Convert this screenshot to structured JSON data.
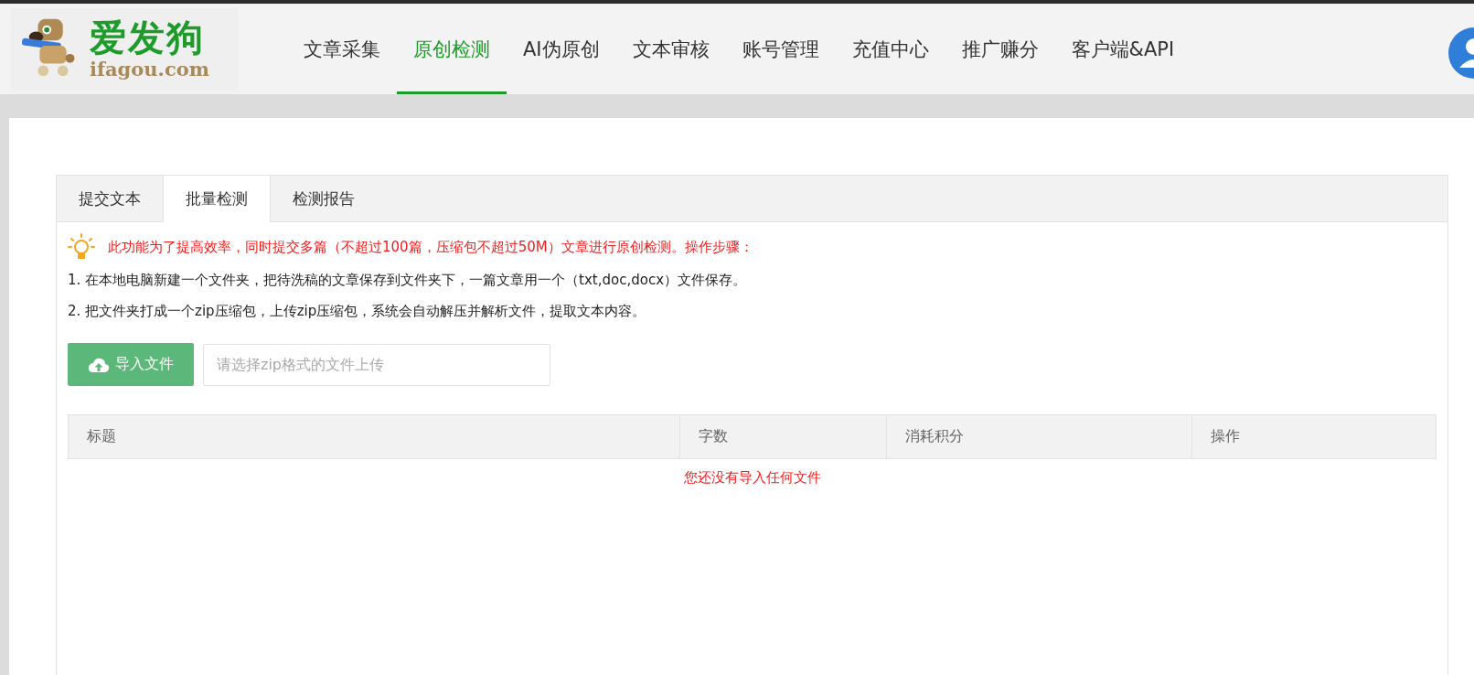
{
  "logo": {
    "title": "爱发狗",
    "domain": "ifagou.com"
  },
  "nav": [
    {
      "label": "文章采集",
      "selected": false
    },
    {
      "label": "原创检测",
      "selected": true
    },
    {
      "label": "AI伪原创",
      "selected": false
    },
    {
      "label": "文本审核",
      "selected": false
    },
    {
      "label": "账号管理",
      "selected": false
    },
    {
      "label": "充值中心",
      "selected": false
    },
    {
      "label": "推广赚分",
      "selected": false
    },
    {
      "label": "客户端&API",
      "selected": false
    }
  ],
  "tabs": [
    {
      "label": "提交文本",
      "selected": false
    },
    {
      "label": "批量检测",
      "selected": true
    },
    {
      "label": "检测报告",
      "selected": false
    }
  ],
  "notice": "此功能为了提高效率，同时提交多篇（不超过100篇，压缩包不超过50M）文章进行原创检测。操作步骤：",
  "steps": [
    "1. 在本地电脑新建一个文件夹，把待洗稿的文章保存到文件夹下，一篇文章用一个（txt,doc,docx）文件保存。",
    "2. 把文件夹打成一个zip压缩包，上传zip压缩包，系统会自动解压并解析文件，提取文本内容。"
  ],
  "upload": {
    "button": "导入文件",
    "placeholder": "请选择zip格式的文件上传"
  },
  "table": {
    "columns": [
      "标题",
      "字数",
      "消耗积分",
      "操作"
    ],
    "empty": "您还没有导入任何文件"
  }
}
